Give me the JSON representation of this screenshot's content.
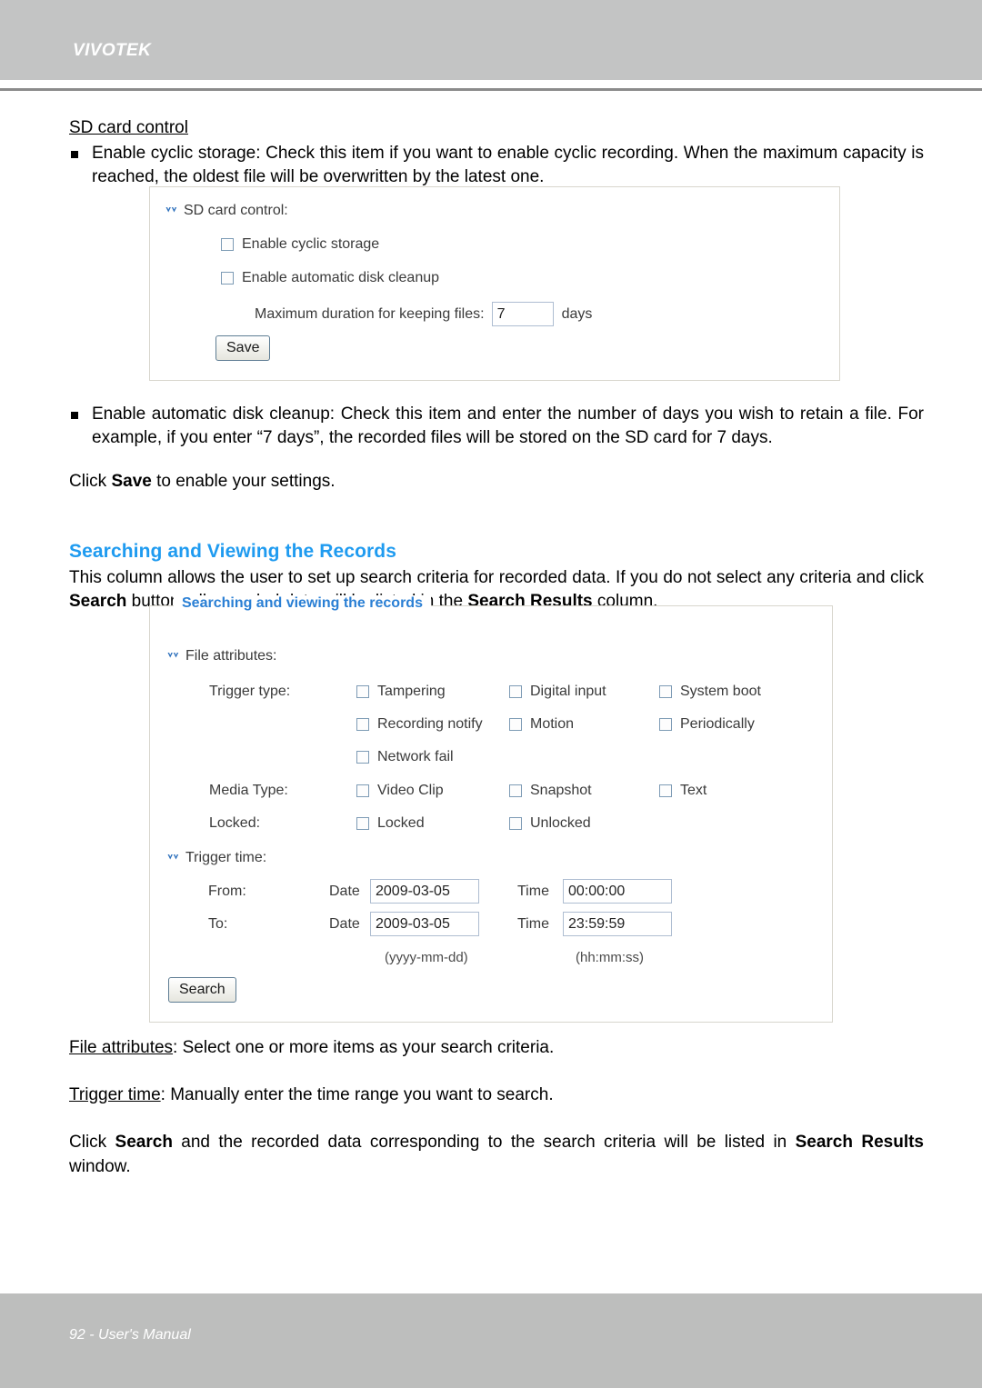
{
  "header": {
    "brand": "VIVOTEK"
  },
  "footer": {
    "text": "92 - User's Manual"
  },
  "section_sd": {
    "title": "SD card control",
    "bullet1_part1": "Enable cyclic storage",
    "bullet1_part2": ": Check this item if you want to enable cyclic recording. When the maximum capacity is reached, the oldest file will be overwritten by the latest one.",
    "bullet2_part1": "Enable automatic disk cleanup",
    "bullet2_part2": ": Check this item and enter the number of days you wish to retain a file. For example, if you enter “7 days”, the recorded files will be stored on the SD card for 7 days.",
    "click_save_pre": "Click ",
    "click_save_bold": "Save",
    "click_save_post": " to enable your settings."
  },
  "sd_panel": {
    "section_label": "SD card control:",
    "cyclic_label": "Enable cyclic storage",
    "cleanup_label": "Enable automatic disk cleanup",
    "duration_label": "Maximum duration for keeping files:",
    "duration_value": "7",
    "duration_unit": "days",
    "save_label": "Save",
    "chevron_color": "#2a6ebb",
    "border_color": "#d8d6cd"
  },
  "section_search": {
    "heading": "Searching and Viewing the Records",
    "intro_1": "This column allows the user to set up search criteria for recorded data. If you do not select any criteria and click ",
    "intro_bold_1": "Search",
    "intro_2": " button, all recorded data will be listed in the ",
    "intro_bold_2": "Search Results",
    "intro_3": " column.",
    "heading_color": "#1f9bf0"
  },
  "search_panel": {
    "legend": "Searching and viewing the records",
    "legend_color": "#2a7fd4",
    "file_attributes_label": "File attributes:",
    "trigger_time_label": "Trigger time:",
    "trigger_type_label": "Trigger type:",
    "media_type_label": "Media Type:",
    "locked_label": "Locked:",
    "trigger_type_options": [
      "Tampering",
      "Digital input",
      "System boot",
      "Recording notify",
      "Motion",
      "Periodically",
      "Network fail"
    ],
    "media_type_options": [
      "Video Clip",
      "Snapshot",
      "Text"
    ],
    "locked_options": [
      "Locked",
      "Unlocked"
    ],
    "from_label": "From:",
    "to_label": "To:",
    "date_label_from": "Date",
    "date_label_to": "Date",
    "time_label_from": "Time",
    "time_label_to": "Time",
    "from_date": "2009-03-05",
    "from_time": "00:00:00",
    "to_date": "2009-03-05",
    "to_time": "23:59:59",
    "date_hint": "(yyyy-mm-dd)",
    "time_hint": "(hh:mm:ss)",
    "search_label": "Search"
  },
  "notes": {
    "file_attr_u": "File attributes",
    "file_attr_rest": ": Select one or more items as your search criteria.",
    "trigger_time_u": "Trigger time",
    "trigger_time_rest": ": Manually enter the time range you want to search.",
    "final_pre": "Click ",
    "final_b1": "Search",
    "final_mid": " and the recorded data corresponding to the search criteria will be listed in ",
    "final_b2": "Search Results",
    "final_post": " window."
  }
}
